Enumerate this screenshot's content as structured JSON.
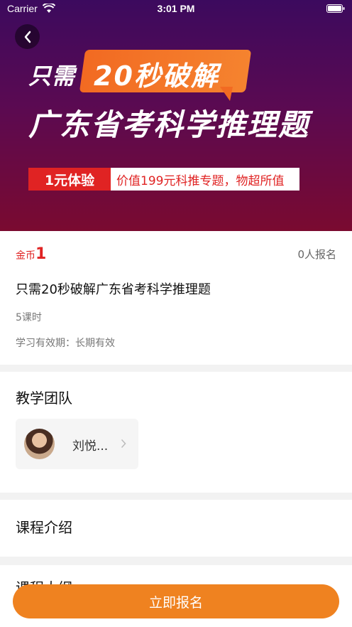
{
  "status_bar": {
    "carrier": "Carrier",
    "time": "3:01 PM"
  },
  "hero": {
    "line1_prefix": "只需",
    "badge_text": "20秒破解",
    "line2": "广东省考科学推理题",
    "tag_red": "1元体验",
    "tag_white": "价值199元科推专题，物超所值",
    "colors": {
      "badge": "#f26a22",
      "tag_red": "#e02323"
    }
  },
  "course": {
    "price_unit": "金币",
    "price_value": "1",
    "enroll_count": "0人报名",
    "title": "只需20秒破解广东省考科学推理题",
    "lessons": "5课时",
    "validity": "学习有效期：长期有效"
  },
  "team": {
    "title": "教学团队",
    "teachers": [
      {
        "name": "刘悦..."
      }
    ]
  },
  "intro": {
    "title": "课程介绍"
  },
  "outline": {
    "title": "课程大纲"
  },
  "cta": {
    "label": "立即报名",
    "color": "#ef8220"
  },
  "icons": [
    "back-icon",
    "wifi-icon",
    "battery-icon",
    "chevron-right-icon"
  ]
}
